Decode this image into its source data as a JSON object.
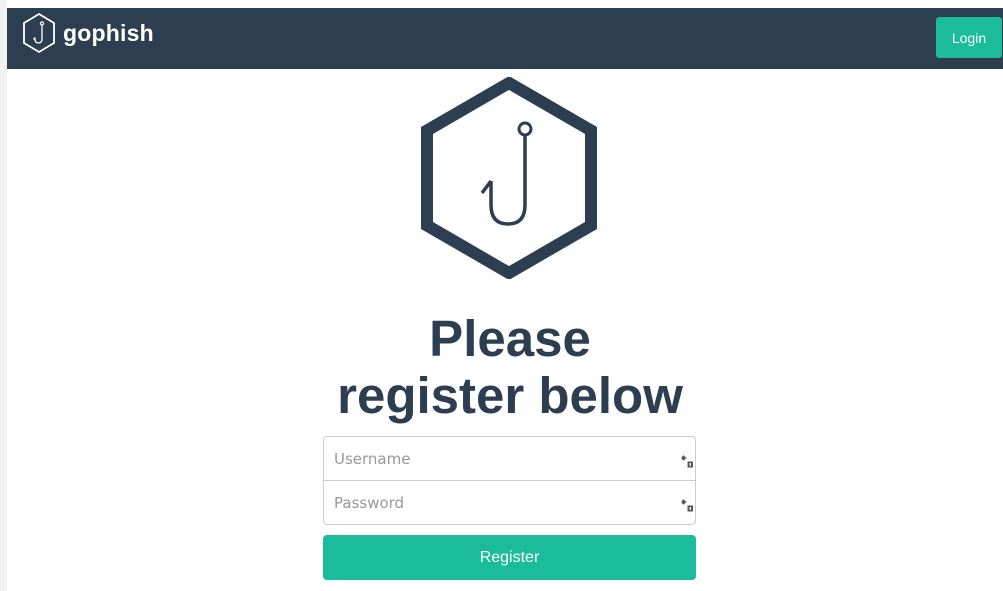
{
  "navbar": {
    "brand_name": "gophish",
    "login_label": "Login",
    "background_color": "#2c3e50",
    "brand_icon": "gophish-hexagon-hook-icon"
  },
  "main": {
    "logo_icon": "gophish-hexagon-hook-icon",
    "heading_line1": "Please",
    "heading_line2": "register below",
    "heading_color": "#2c3e50"
  },
  "form": {
    "username": {
      "value": "",
      "placeholder": "Username",
      "icon": "password-manager-key-icon"
    },
    "password": {
      "value": "",
      "placeholder": "Password",
      "icon": "password-manager-key-icon"
    },
    "register_label": "Register",
    "accent_color": "#1abc9c"
  }
}
